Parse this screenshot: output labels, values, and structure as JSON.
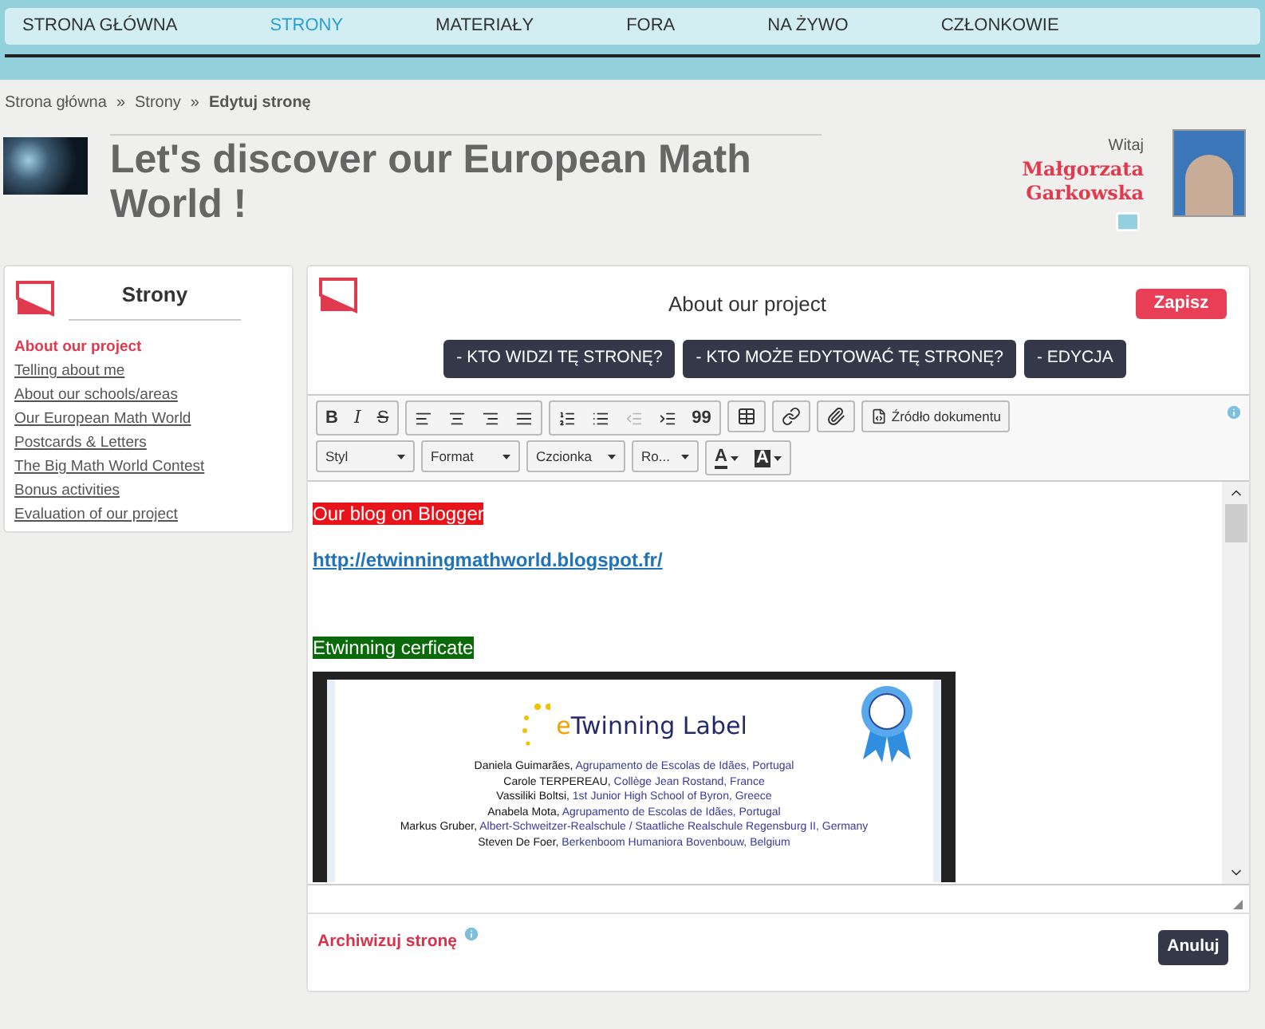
{
  "nav": {
    "items": [
      {
        "label": "STRONA GŁÓWNA",
        "selected": false
      },
      {
        "label": "STRONY",
        "selected": true
      },
      {
        "label": "MATERIAŁY",
        "selected": false
      },
      {
        "label": "FORA",
        "selected": false
      },
      {
        "label": "NA ŻYWO",
        "selected": false
      },
      {
        "label": "CZŁONKOWIE",
        "selected": false
      }
    ]
  },
  "breadcrumb": {
    "items": [
      "Strona główna",
      "Strony"
    ],
    "separator": "»",
    "current": "Edytuj stronę"
  },
  "header": {
    "title": "Let's discover our European Math World !",
    "greeting": "Witaj",
    "user_name": "Małgorzata Garkowska"
  },
  "sidebar": {
    "title": "Strony",
    "items": [
      {
        "label": "About our project",
        "selected": true
      },
      {
        "label": "Telling about me",
        "selected": false
      },
      {
        "label": "About our schools/areas",
        "selected": false
      },
      {
        "label": "Our European Math World",
        "selected": false
      },
      {
        "label": "Postcards & Letters",
        "selected": false
      },
      {
        "label": "The Big Math World Contest",
        "selected": false
      },
      {
        "label": "Bonus activities",
        "selected": false
      },
      {
        "label": "Evaluation of our project",
        "selected": false
      }
    ]
  },
  "editor_panel": {
    "page_title": "About our project",
    "save_button": "Zapisz",
    "option_buttons": [
      "- KTO WIDZI TĘ STRONĘ?",
      "- KTO MOŻE EDYTOWAĆ TĘ STRONĘ?",
      "- EDYCJA"
    ],
    "toolbar": {
      "format_buttons": [
        "B",
        "I",
        "S"
      ],
      "quote_button": "99",
      "source_button": "Źródło dokumentu",
      "dropdowns": [
        "Styl",
        "Format",
        "Czcionka",
        "Ro..."
      ],
      "color_buttons": [
        "A",
        "A"
      ]
    },
    "content": {
      "blog_heading": "Our blog on Blogger",
      "blog_link": "http://etwinningmathworld.blogspot.fr/",
      "certificate_heading": "Etwinning cerficate",
      "certificate": {
        "title_prefix": "e",
        "title": "Twinning Label",
        "entries": [
          {
            "name": "Daniela Guimarães,",
            "school": "Agrupamento de Escolas de Idães, Portugal"
          },
          {
            "name": "Carole TERPEREAU,",
            "school": "Collège Jean Rostand, France"
          },
          {
            "name": "Vassiliki Boltsi,",
            "school": "1st Junior High School of Byron, Greece"
          },
          {
            "name": "Anabela Mota,",
            "school": "Agrupamento de Escolas de Idães, Portugal"
          },
          {
            "name": "Markus Gruber,",
            "school": "Albert-Schweitzer-Realschule / Staatliche Realschule Regensburg II, Germany"
          },
          {
            "name": "Steven De Foer,",
            "school": "Berkenboom Humaniora Bovenbouw, Belgium"
          }
        ]
      }
    },
    "archive_link": "Archiwizuj stronę",
    "cancel_button": "Anuluj"
  }
}
